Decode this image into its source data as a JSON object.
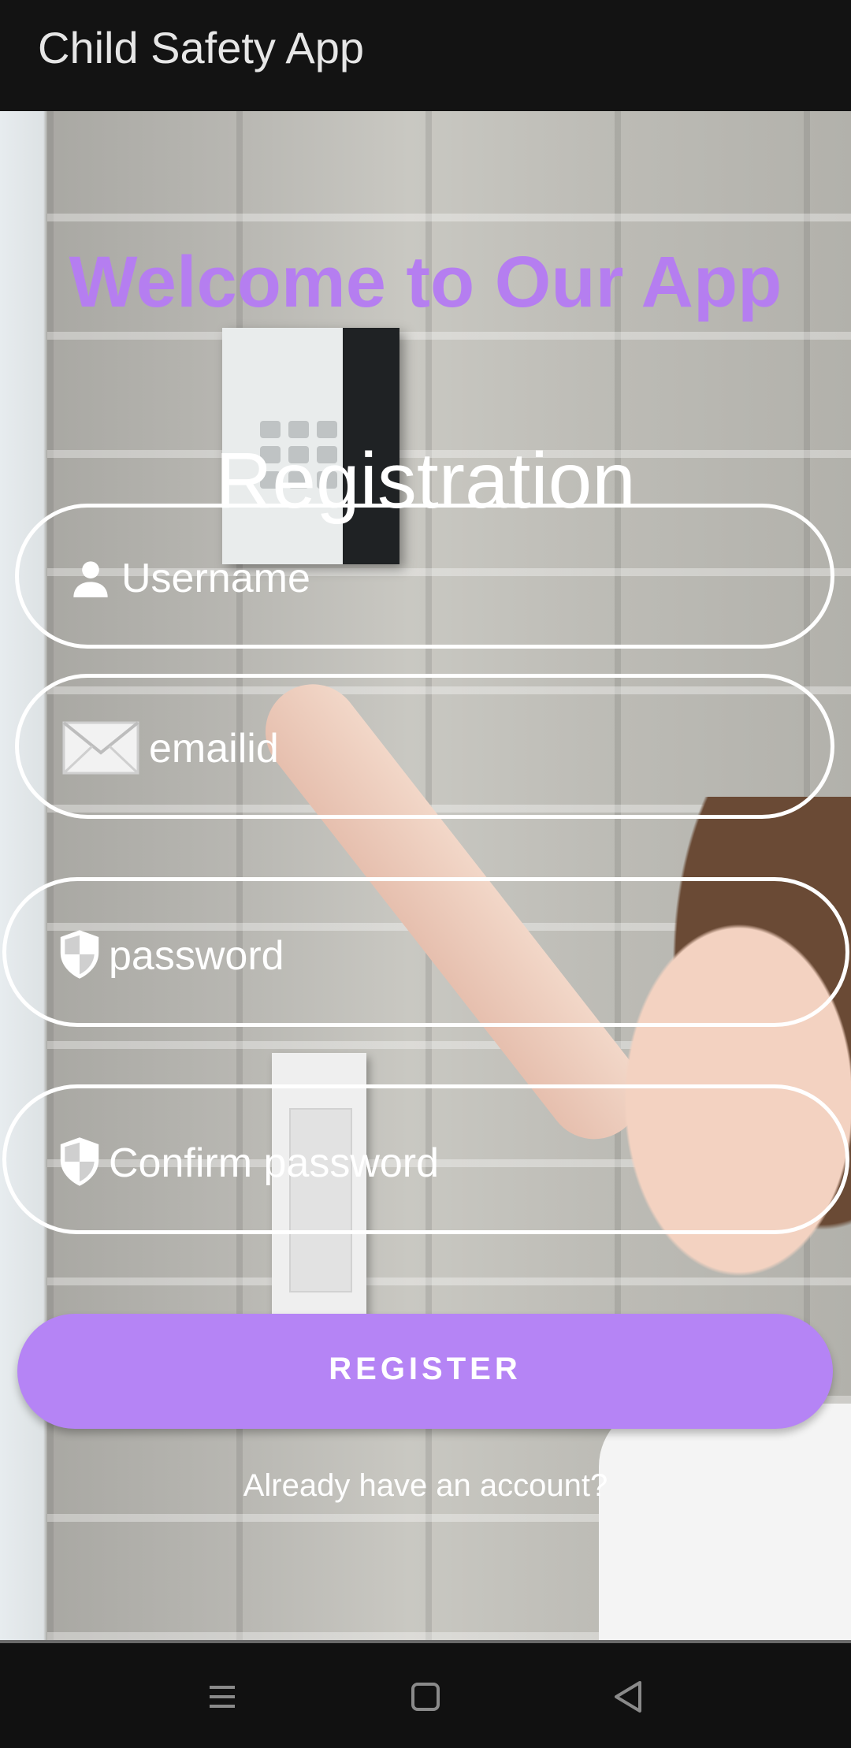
{
  "app_bar": {
    "title": "Child Safety App"
  },
  "header": {
    "welcome": "Welcome to Our App",
    "title": "Registration"
  },
  "form": {
    "username": {
      "placeholder": "Username",
      "icon": "person-icon"
    },
    "email": {
      "placeholder": "emailid",
      "icon": "envelope-icon"
    },
    "password": {
      "placeholder": "password",
      "icon": "shield-icon"
    },
    "confirm_password": {
      "placeholder": "Confirm password",
      "icon": "shield-icon"
    },
    "register_label": "REGISTER",
    "login_link": "Already have an account?"
  },
  "nav": {
    "icons": [
      "menu-icon",
      "home-square-icon",
      "back-triangle-icon"
    ]
  },
  "colors": {
    "accent": "#b584f5",
    "app_bar": "#131313",
    "field_border": "#ffffff"
  }
}
